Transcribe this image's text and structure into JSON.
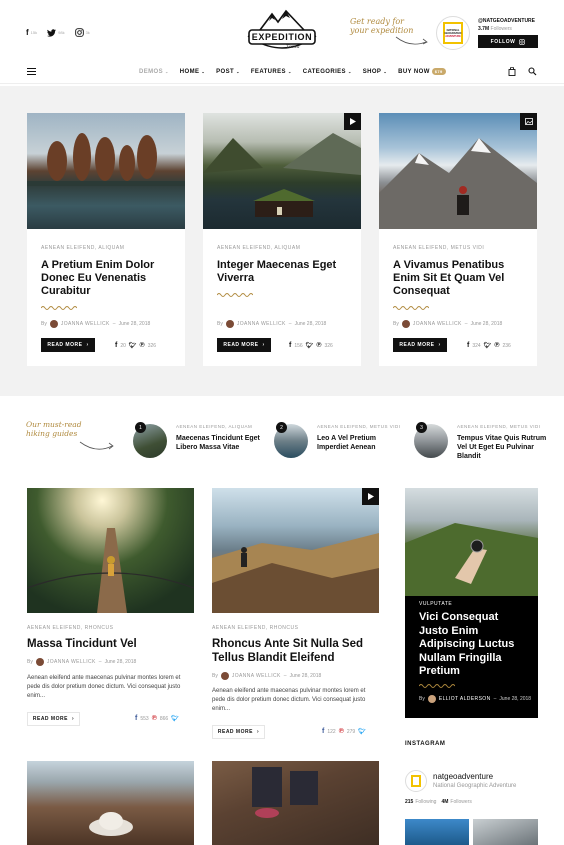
{
  "topbar": {
    "social": [
      {
        "icon": "facebook-icon",
        "count": "15k"
      },
      {
        "icon": "twitter-icon",
        "count": "98k"
      },
      {
        "icon": "instagram-icon",
        "count": "3k"
      }
    ],
    "logo_text": "EXPEDITION",
    "logo_sub": "Tema",
    "tagline_1": "Get ready for",
    "tagline_2": "your expedition",
    "badge_line1": "NATIONAL",
    "badge_line2": "GEOGRAPHIC",
    "badge_line3": "ADVENTURE",
    "ig_handle": "@NATGEOADVENTURE",
    "ig_followers": "3.7M",
    "ig_followers_label": "Followers",
    "follow_label": "FOLLOW"
  },
  "nav": {
    "items": [
      {
        "label": "DEMOS",
        "muted": true
      },
      {
        "label": "HOME"
      },
      {
        "label": "POST"
      },
      {
        "label": "FEATURES"
      },
      {
        "label": "CATEGORIES"
      },
      {
        "label": "SHOP"
      },
      {
        "label": "BUY NOW"
      }
    ],
    "buy_badge": "$79"
  },
  "featured": [
    {
      "cats": "AENEAN ELEIFEND, ALIQUAM",
      "title": "A Pretium Enim Dolor Donec Eu Venenatis Curabitur",
      "author": "JOANNA WELLICK",
      "date": "June 28, 2018",
      "read": "READ MORE",
      "fb": "20",
      "pin": "326",
      "format_icon": ""
    },
    {
      "cats": "AENEAN ELEIFEND, ALIQUAM",
      "title": "Integer Maecenas Eget Viverra",
      "author": "JOANNA WELLICK",
      "date": "June 28, 2018",
      "read": "READ MORE",
      "fb": "156",
      "pin": "326",
      "format_icon": "play-icon"
    },
    {
      "cats": "AENEAN ELEIFEND, METUS VIDI",
      "title": "A Vivamus Penatibus Enim Sit Et Quam Vel Consequat",
      "author": "JOANNA WELLICK",
      "date": "June 28, 2018",
      "read": "READ MORE",
      "fb": "324",
      "pin": "236",
      "format_icon": "image-icon"
    }
  ],
  "mustread": {
    "label_1": "Our must-read",
    "label_2": "hiking guides",
    "items": [
      {
        "num": "1",
        "cats": "AENEAN ELEIFEND, ALIQUAM",
        "title": "Maecenas Tincidunt Eget Libero Massa Vitae"
      },
      {
        "num": "2",
        "cats": "AENEAN ELEIFEND, METUS VIDI",
        "title": "Leo A Vel Pretium Imperdiet Aenean"
      },
      {
        "num": "3",
        "cats": "AENEAN ELEIFEND, METUS VIDI",
        "title": "Tempus Vitae Quis Rutrum Vel Ut Eget Eu Pulvinar Blandit"
      }
    ]
  },
  "posts": [
    {
      "cats": "AENEAN ELEIFEND, RHONCUS",
      "title": "Massa Tincidunt Vel",
      "author": "JOANNA WELLICK",
      "date": "June 28, 2018",
      "excerpt": "Aenean eleifend ante maecenas pulvinar montes lorem et pede dis dolor pretium donec dictum. Vici consequat justo enim...",
      "read": "READ MORE",
      "fb": "553",
      "pin": "866"
    },
    {
      "cats": "AENEAN ELEIFEND, RHONCUS",
      "title": "Rhoncus Ante Sit Nulla Sed Tellus Blandit Eleifend",
      "author": "JOANNA WELLICK",
      "date": "June 28, 2018",
      "excerpt": "Aenean eleifend ante maecenas pulvinar montes lorem et pede dis dolor pretium donec dictum. Vici consequat justo enim...",
      "read": "READ MORE",
      "fb": "122",
      "pin": "279"
    }
  ],
  "sidebar": {
    "promo_cat": "VULPUTATE",
    "promo_title": "Vici Consequat Justo Enim Adipiscing Luctus Nullam Fringilla Pretium",
    "promo_author": "ELLIOT ALDERSON",
    "promo_date": "June 28, 2018",
    "ig_heading": "INSTAGRAM",
    "ig_name": "natgeoadventure",
    "ig_full": "National Geographic Adventure",
    "ig_following": "215",
    "ig_following_label": "Following",
    "ig_followers": "4M",
    "ig_followers_label": "Followers"
  },
  "by_label": "By"
}
